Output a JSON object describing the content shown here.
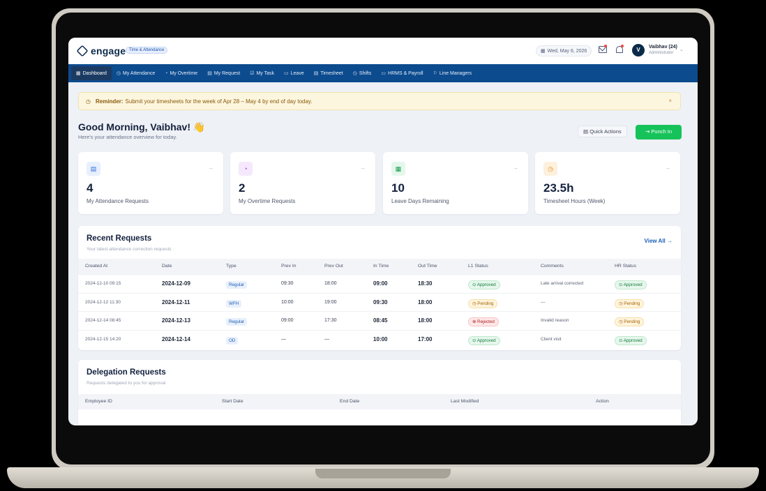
{
  "header": {
    "logo_text": "engage",
    "module_tag": "Time & Attendance",
    "date": "Wed, May 6, 2026",
    "user_name": "Vaibhav (24)",
    "user_role": "Administrator",
    "avatar_initial": "V"
  },
  "nav": [
    {
      "label": "Dashboard",
      "icon": "grid-icon",
      "glyph": "▦"
    },
    {
      "label": "My Attendance",
      "icon": "clock-icon",
      "glyph": "◷"
    },
    {
      "label": "My Overtime",
      "icon": "timer-icon",
      "glyph": "◔"
    },
    {
      "label": "My Request",
      "icon": "document-icon",
      "glyph": "▤"
    },
    {
      "label": "My Task",
      "icon": "task-icon",
      "glyph": "☑"
    },
    {
      "label": "Leave",
      "icon": "leave-icon",
      "glyph": "▭"
    },
    {
      "label": "Timesheet",
      "icon": "timesheet-icon",
      "glyph": "▤"
    },
    {
      "label": "Shifts",
      "icon": "shifts-icon",
      "glyph": "◷"
    },
    {
      "label": "HRMS & Payroll",
      "icon": "payroll-icon",
      "glyph": "▭"
    },
    {
      "label": "Line Managers",
      "icon": "managers-icon",
      "glyph": "⚐"
    }
  ],
  "reminder": {
    "prefix": "Reminder:",
    "text": "Submit your timesheets for the week of Apr 28 – May 4 by end of day today.",
    "close": "×"
  },
  "greeting": {
    "title": "Good Morning, Vaibhav! 👋",
    "subtitle": "Here's your attendance overview for today.",
    "quick_actions": "Quick Actions",
    "punch_in": "Punch In"
  },
  "stats": [
    {
      "value": "4",
      "label": "My Attendance Requests",
      "icon": "document-icon",
      "glyph": "▤",
      "color": "#2f6fd0",
      "bg": "#e8f0fd"
    },
    {
      "value": "2",
      "label": "My Overtime Requests",
      "icon": "stopwatch-icon",
      "glyph": "◔",
      "color": "#a23bd6",
      "bg": "#f5e8fd"
    },
    {
      "value": "10",
      "label": "Leave Days Remaining",
      "icon": "calendar-icon",
      "glyph": "▦",
      "color": "#169b4a",
      "bg": "#e5f7ec"
    },
    {
      "value": "23.5h",
      "label": "Timesheet Hours (Week)",
      "icon": "clock-icon",
      "glyph": "◷",
      "color": "#e08a12",
      "bg": "#fdf1dd"
    }
  ],
  "recent": {
    "title": "Recent Requests",
    "subtitle": "Your latest attendance correction requests",
    "view_all": "View All →",
    "columns": [
      "Created At",
      "Date",
      "Type",
      "Prev In",
      "Prev Out",
      "In Time",
      "Out Time",
      "L1 Status",
      "Comments",
      "HR Status"
    ],
    "rows": [
      {
        "created": "2024-12-10 09:15",
        "date": "2024-12-09",
        "type": "Regular",
        "prev_in": "09:30",
        "prev_out": "18:00",
        "in_time": "09:00",
        "out_time": "18:30",
        "l1": "Approved",
        "comments": "Late arrival corrected",
        "hr": "Approved"
      },
      {
        "created": "2024-12-12 11:30",
        "date": "2024-12-11",
        "type": "WFH",
        "prev_in": "10:00",
        "prev_out": "19:00",
        "in_time": "09:30",
        "out_time": "18:00",
        "l1": "Pending",
        "comments": "—",
        "hr": "Pending"
      },
      {
        "created": "2024-12-14 08:45",
        "date": "2024-12-13",
        "type": "Regular",
        "prev_in": "09:00",
        "prev_out": "17:30",
        "in_time": "08:45",
        "out_time": "18:00",
        "l1": "Rejected",
        "comments": "Invalid reason",
        "hr": "Pending"
      },
      {
        "created": "2024-12-15 14:20",
        "date": "2024-12-14",
        "type": "OD",
        "prev_in": "—",
        "prev_out": "—",
        "in_time": "10:00",
        "out_time": "17:00",
        "l1": "Approved",
        "comments": "Client visit",
        "hr": "Approved"
      }
    ]
  },
  "delegation": {
    "title": "Delegation Requests",
    "subtitle": "Requests delegated to you for approval",
    "columns": [
      "Employee ID",
      "Start Date",
      "End Date",
      "Last Modified",
      "Action"
    ]
  }
}
